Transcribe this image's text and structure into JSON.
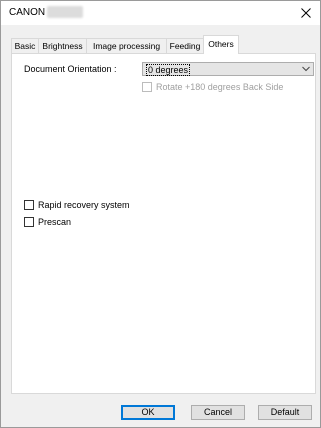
{
  "window": {
    "title": "CANON"
  },
  "tabs": [
    {
      "label": "Basic"
    },
    {
      "label": "Brightness"
    },
    {
      "label": "Image processing"
    },
    {
      "label": "Feeding"
    },
    {
      "label": "Others",
      "active": true
    }
  ],
  "others": {
    "orientation_label": "Document Orientation :",
    "orientation_value": "0 degrees",
    "rotate_back_label": "Rotate +180 degrees Back Side",
    "rapid_recovery_label": "Rapid recovery system",
    "prescan_label": "Prescan"
  },
  "buttons": {
    "ok": "OK",
    "cancel": "Cancel",
    "default": "Default"
  }
}
